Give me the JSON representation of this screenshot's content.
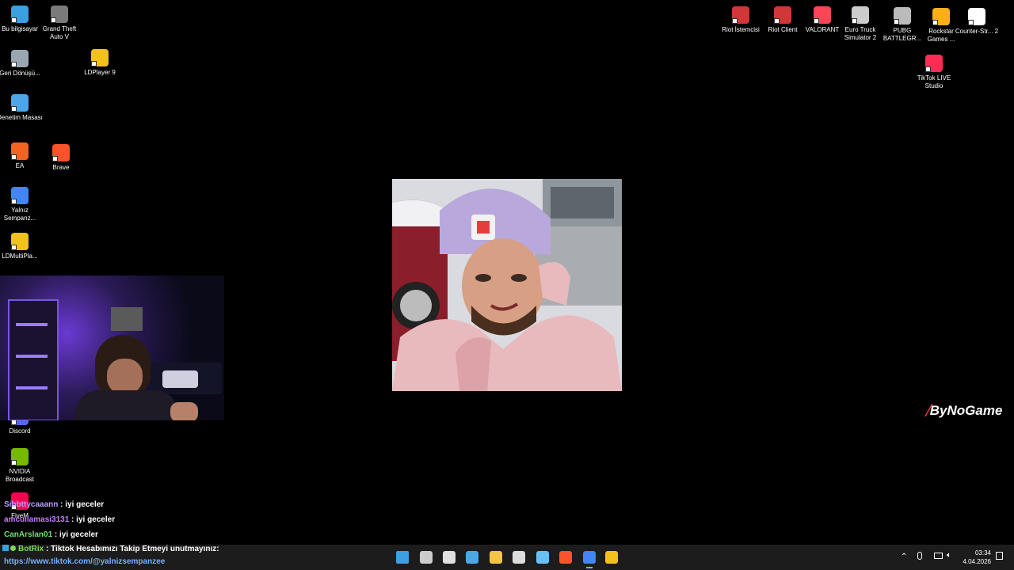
{
  "desktop": {
    "left_icons": [
      {
        "label": "Bu bilgisayar",
        "icon": "computer-icon",
        "color": "#3aa0e0"
      },
      {
        "label": "Grand Theft Auto V",
        "icon": "gta-icon",
        "color": "#7a7a7a"
      },
      {
        "label": "Geri Dönüşü...",
        "icon": "recycle-bin-icon",
        "color": "#9aa7b3"
      },
      {
        "label": "LDPlayer 9",
        "icon": "ldplayer-icon",
        "color": "#f2c21b"
      },
      {
        "label": "Denetim Masası",
        "icon": "control-panel-icon",
        "color": "#4da6e8"
      },
      {
        "label": "EA",
        "icon": "ea-icon",
        "color": "#f26422"
      },
      {
        "label": "Brave",
        "icon": "brave-icon",
        "color": "#fb542b"
      },
      {
        "label": "Yalnız Sempanz...",
        "icon": "chrome-icon",
        "color": "#4285f4"
      },
      {
        "label": "LDMultiPla...",
        "icon": "ldmultiplayer-icon",
        "color": "#f2c21b"
      },
      {
        "label": "Discord",
        "icon": "discord-icon",
        "color": "#5865f2"
      },
      {
        "label": "NVIDIA Broadcast",
        "icon": "nvidia-icon",
        "color": "#76b900"
      },
      {
        "label": "FiveM",
        "icon": "fivem-icon",
        "color": "#f40552"
      }
    ],
    "right_icons": [
      {
        "label": "Riot İstemcisi",
        "icon": "riot-icon",
        "color": "#d13639"
      },
      {
        "label": "Riot Client",
        "icon": "riot-icon",
        "color": "#d13639"
      },
      {
        "label": "VALORANT",
        "icon": "valorant-icon",
        "color": "#fd4556"
      },
      {
        "label": "Euro Truck Simulator 2",
        "icon": "ets2-icon",
        "color": "#cccccc"
      },
      {
        "label": "PUBG BATTLEGR...",
        "icon": "pubg-icon",
        "color": "#bbbbbb"
      },
      {
        "label": "Rockstar Games ...",
        "icon": "rockstar-icon",
        "color": "#fcaf17"
      },
      {
        "label": "Counter-Str... 2",
        "icon": "file-icon",
        "color": "#ffffff"
      },
      {
        "label": "TikTok LIVE Studio",
        "icon": "tiktok-live-icon",
        "color": "#fe2c55"
      }
    ]
  },
  "overlay": {
    "brand": "ByNoGame"
  },
  "chat": [
    {
      "nick": "Sibbttycaaann",
      "sep": " : ",
      "message": "iyi geceler",
      "color": "#b9a0ff"
    },
    {
      "nick": "amcullamasi3131",
      "sep": " : ",
      "message": "iyi geceler",
      "color": "#c77dff"
    },
    {
      "nick": "CanArslan01",
      "sep": " : ",
      "message": "iyi geceler",
      "color": "#6fe06f"
    },
    {
      "nick": "BotRix",
      "sep": " : ",
      "message": "Tiktok Hesabımızı Takip Etmeyi unutmayınız:",
      "color": "#7ed957"
    }
  ],
  "chat_link": "https://www.tiktok.com/@yalnizsempanzee",
  "taskbar": {
    "apps": [
      {
        "name": "start-button-icon",
        "color": "#3aa0e0"
      },
      {
        "name": "task-view-icon",
        "color": "#cccccc"
      },
      {
        "name": "snipping-tool-icon",
        "color": "#e0e0e0"
      },
      {
        "name": "photos-icon",
        "color": "#4da6e8"
      },
      {
        "name": "file-explorer-icon",
        "color": "#f4c542"
      },
      {
        "name": "obs-icon",
        "color": "#dddddd"
      },
      {
        "name": "steam-icon",
        "color": "#66c0f4"
      },
      {
        "name": "brave-icon",
        "color": "#fb542b"
      },
      {
        "name": "chrome-icon",
        "color": "#4285f4"
      },
      {
        "name": "media-player-icon",
        "color": "#f2c21b"
      }
    ],
    "time": "03:34",
    "date": "4.04.2026"
  }
}
